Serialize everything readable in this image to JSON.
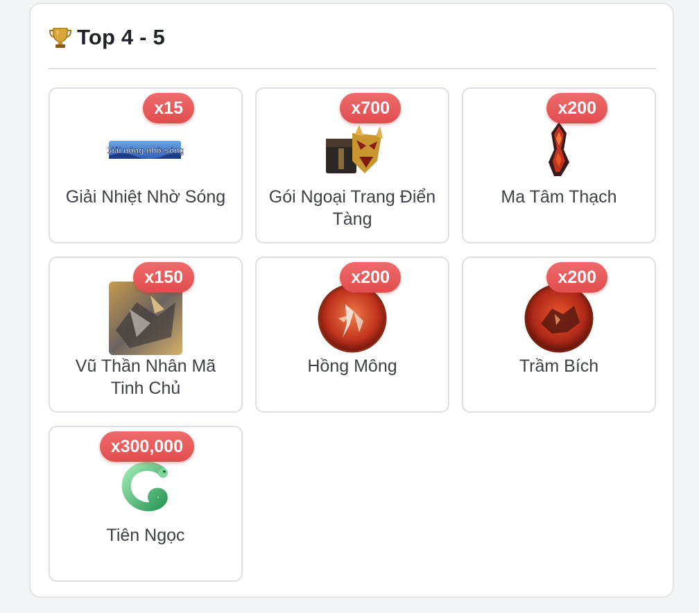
{
  "section": {
    "title": "Top 4 - 5",
    "icon": "trophy-icon"
  },
  "colors": {
    "badge": "#e4585a",
    "card_border": "#dcdfe3",
    "text": "#3c4046"
  },
  "rewards": [
    {
      "name": "Giải Nhiệt Nhờ Sóng",
      "quantity": "x15",
      "image_text": "Giải nóng nhờ sóng",
      "icon": "banner-icon"
    },
    {
      "name": "Gói Ngoại Trang Điển Tàng",
      "quantity": "x700",
      "icon": "costume-chest-icon"
    },
    {
      "name": "Ma Tâm Thạch",
      "quantity": "x200",
      "icon": "demon-stone-icon"
    },
    {
      "name": "Vũ Thần Nhân Mã Tinh Chủ",
      "quantity": "x150",
      "icon": "centaur-warrior-icon"
    },
    {
      "name": "Hồng Mông",
      "quantity": "x200",
      "icon": "red-orb-warrior-icon"
    },
    {
      "name": "Trầm Bích",
      "quantity": "x200",
      "icon": "red-orb-beast-icon"
    },
    {
      "name": "Tiên Ngọc",
      "quantity": "x300,000",
      "icon": "jade-dragon-icon"
    }
  ]
}
